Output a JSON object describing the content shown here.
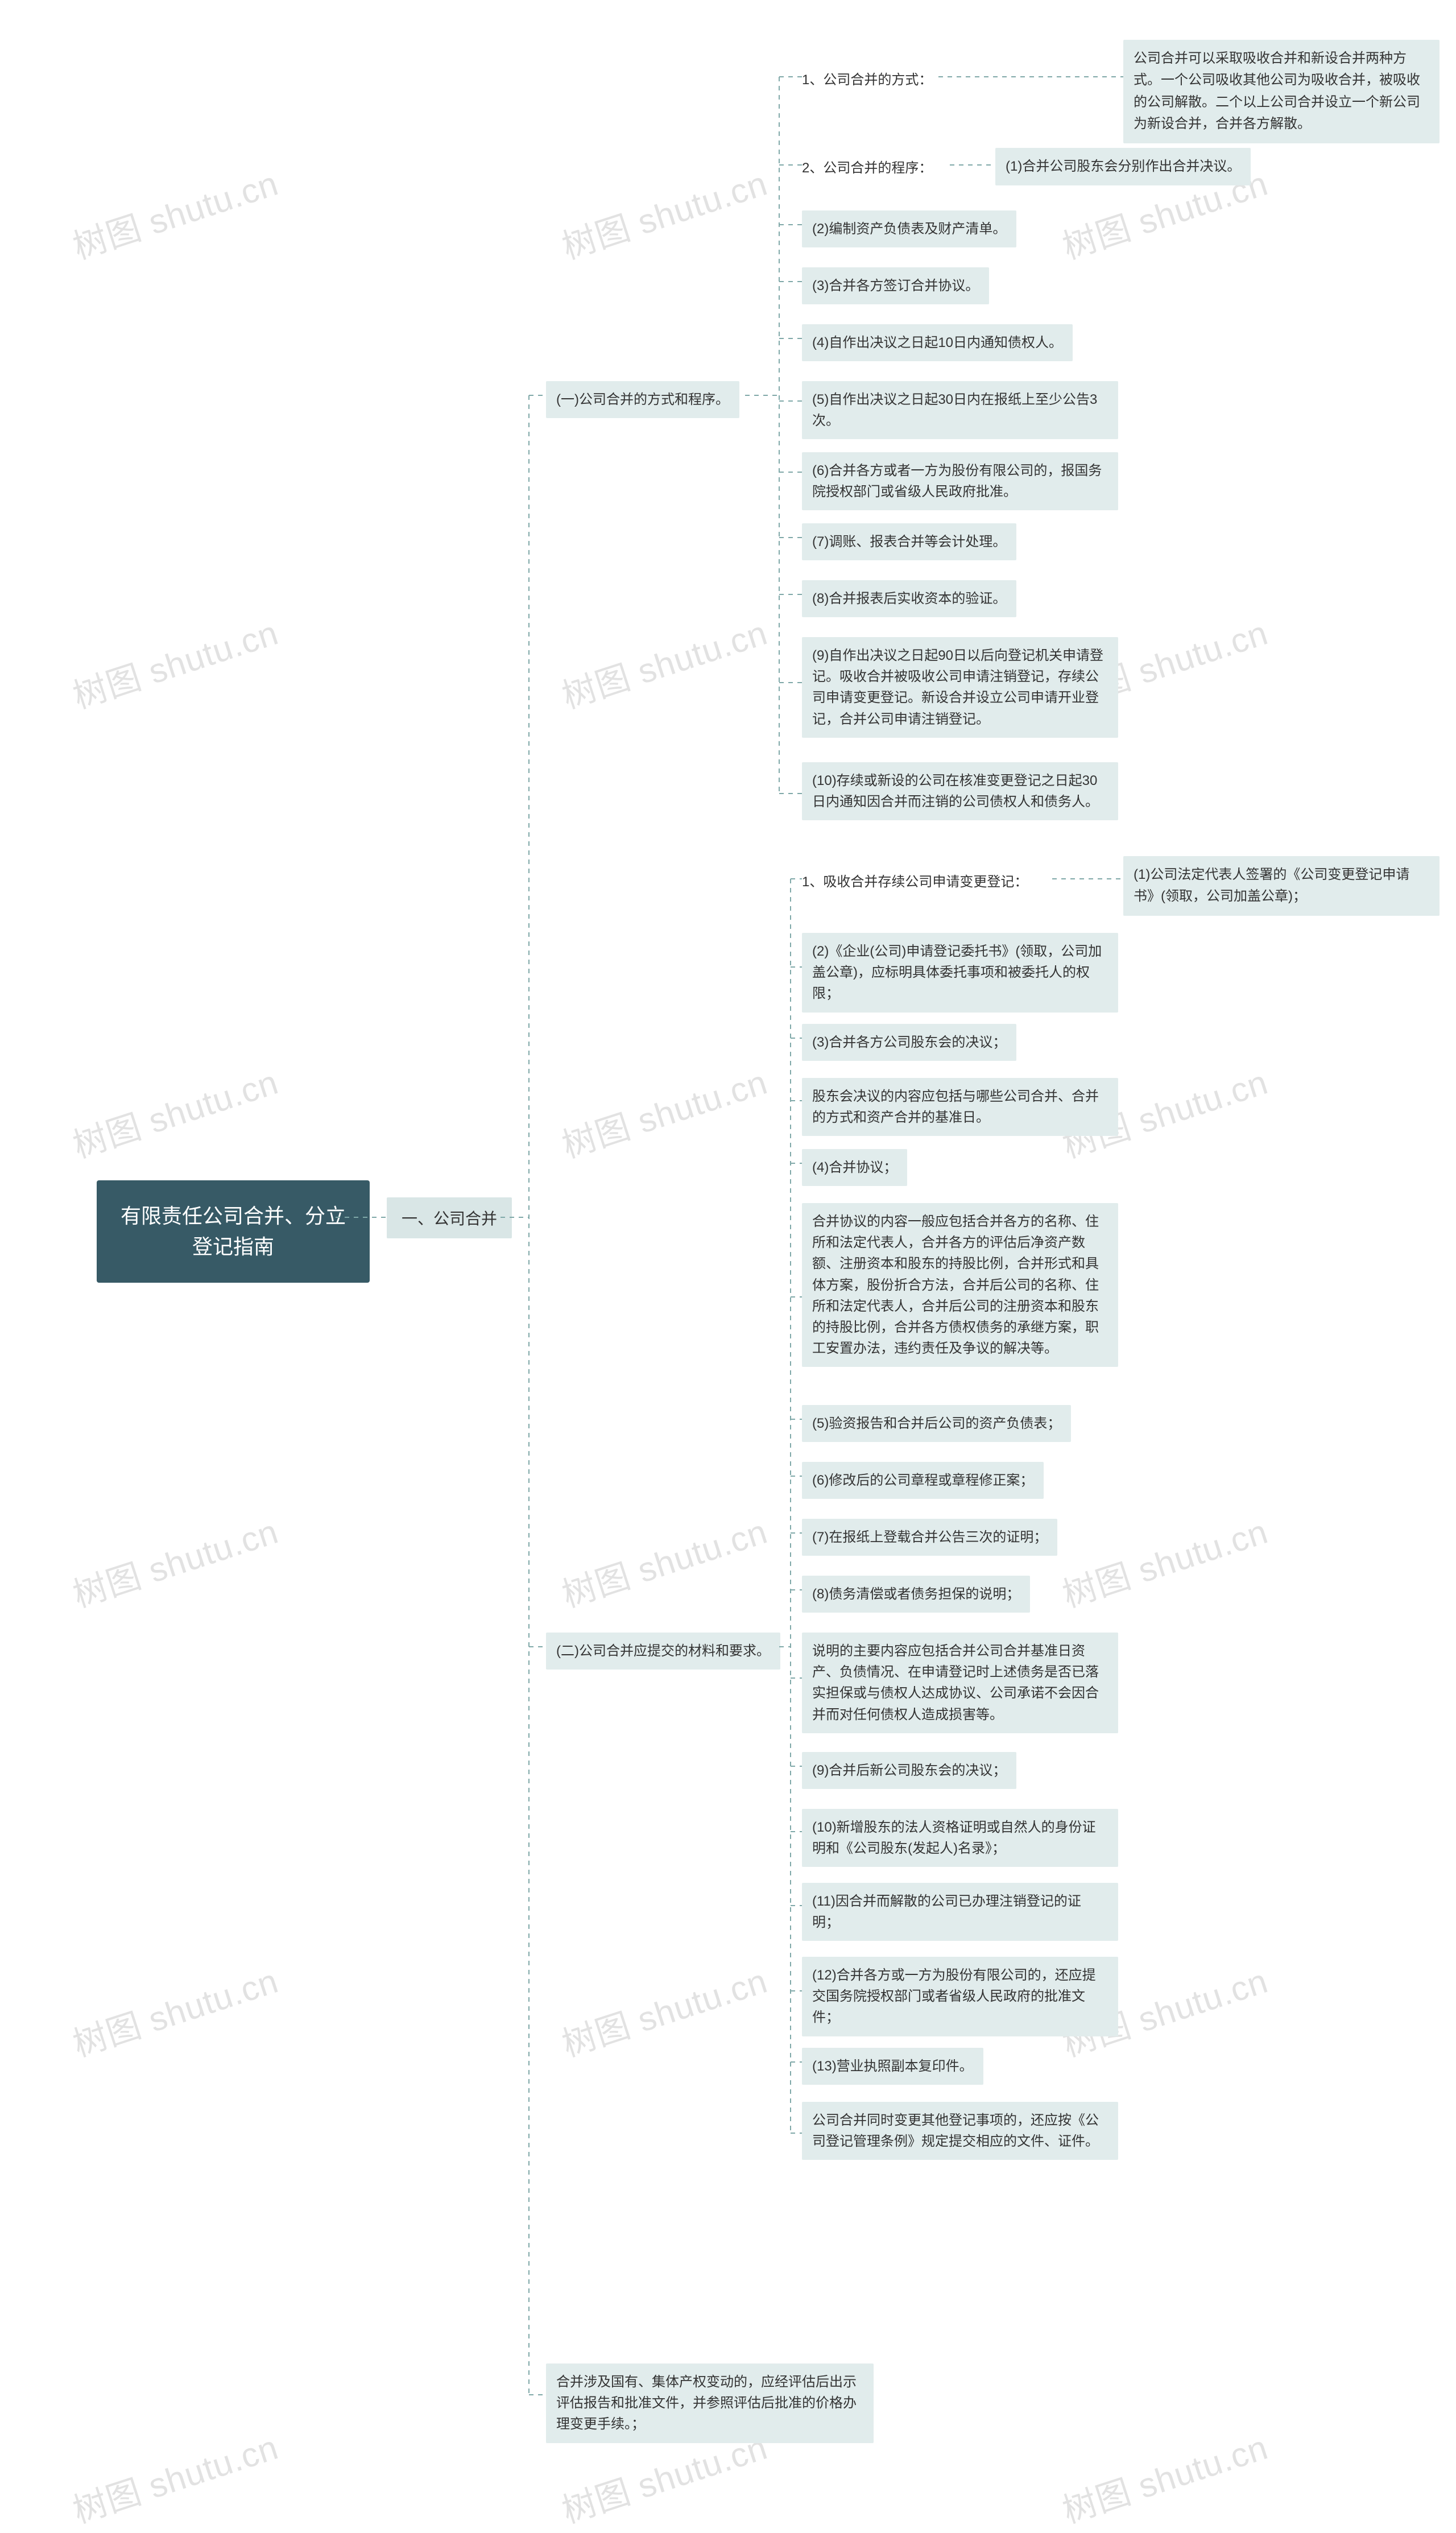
{
  "watermark": "树图 shutu.cn",
  "root": {
    "title": "有限责任公司合并、分立登记指南"
  },
  "lvl2": {
    "label": "一、公司合并"
  },
  "sectionA": {
    "label": "(一)公司合并的方式和程序。",
    "a1_label": "1、公司合并的方式：",
    "a1_desc": "公司合并可以采取吸收合并和新设合并两种方式。一个公司吸收其他公司为吸收合并，被吸收的公司解散。二个以上公司合并设立一个新公司为新设合并，合并各方解散。",
    "a2_label": "2、公司合并的程序：",
    "a2_step1": "(1)合并公司股东会分别作出合并决议。",
    "steps": {
      "s2": "(2)编制资产负债表及财产清单。",
      "s3": "(3)合并各方签订合并协议。",
      "s4": "(4)自作出决议之日起10日内通知债权人。",
      "s5": "(5)自作出决议之日起30日内在报纸上至少公告3次。",
      "s6": "(6)合并各方或者一方为股份有限公司的，报国务院授权部门或省级人民政府批准。",
      "s7": "(7)调账、报表合并等会计处理。",
      "s8": "(8)合并报表后实收资本的验证。",
      "s9": "(9)自作出决议之日起90日以后向登记机关申请登记。吸收合并被吸收公司申请注销登记，存续公司申请变更登记。新设合并设立公司申请开业登记，合并公司申请注销登记。",
      "s10": "(10)存续或新设的公司在核准变更登记之日起30日内通知因合并而注销的公司债权人和债务人。"
    }
  },
  "sectionB": {
    "label": "(二)公司合并应提交的材料和要求。",
    "b1_label": "1、吸收合并存续公司申请变更登记：",
    "b1_sub": "(1)公司法定代表人签署的《公司变更登记申请书》(领取，公司加盖公章)；",
    "items": {
      "i2": "(2)《企业(公司)申请登记委托书》(领取，公司加盖公章)，应标明具体委托事项和被委托人的权限；",
      "i3": "(3)合并各方公司股东会的决议；",
      "i3b": "股东会决议的内容应包括与哪些公司合并、合并的方式和资产合并的基准日。",
      "i4": "(4)合并协议；",
      "i4b": "合并协议的内容一般应包括合并各方的名称、住所和法定代表人，合并各方的评估后净资产数额、注册资本和股东的持股比例，合并形式和具体方案，股份折合方法，合并后公司的名称、住所和法定代表人，合并后公司的注册资本和股东的持股比例，合并各方债权债务的承继方案，职工安置办法，违约责任及争议的解决等。",
      "i5": "(5)验资报告和合并后公司的资产负债表；",
      "i6": "(6)修改后的公司章程或章程修正案；",
      "i7": "(7)在报纸上登载合并公告三次的证明；",
      "i8": "(8)债务清偿或者债务担保的说明；",
      "i8b": "说明的主要内容应包括合并公司合并基准日资产、负债情况、在申请登记时上述债务是否已落实担保或与债权人达成协议、公司承诺不会因合并而对任何债权人造成损害等。",
      "i9": "(9)合并后新公司股东会的决议；",
      "i10": "(10)新增股东的法人资格证明或自然人的身份证明和《公司股东(发起人)名录》；",
      "i11": "(11)因合并而解散的公司已办理注销登记的证明；",
      "i12": "(12)合并各方或一方为股份有限公司的，还应提交国务院授权部门或者省级人民政府的批准文件；",
      "i13": "(13)营业执照副本复印件。",
      "tail": "公司合并同时变更其他登记事项的，还应按《公司登记管理条例》规定提交相应的文件、证件。"
    }
  },
  "sectionC": {
    "text": "合并涉及国有、集体产权变动的，应经评估后出示评估报告和批准文件，并参照评估后批准的价格办理变更手续。；"
  }
}
